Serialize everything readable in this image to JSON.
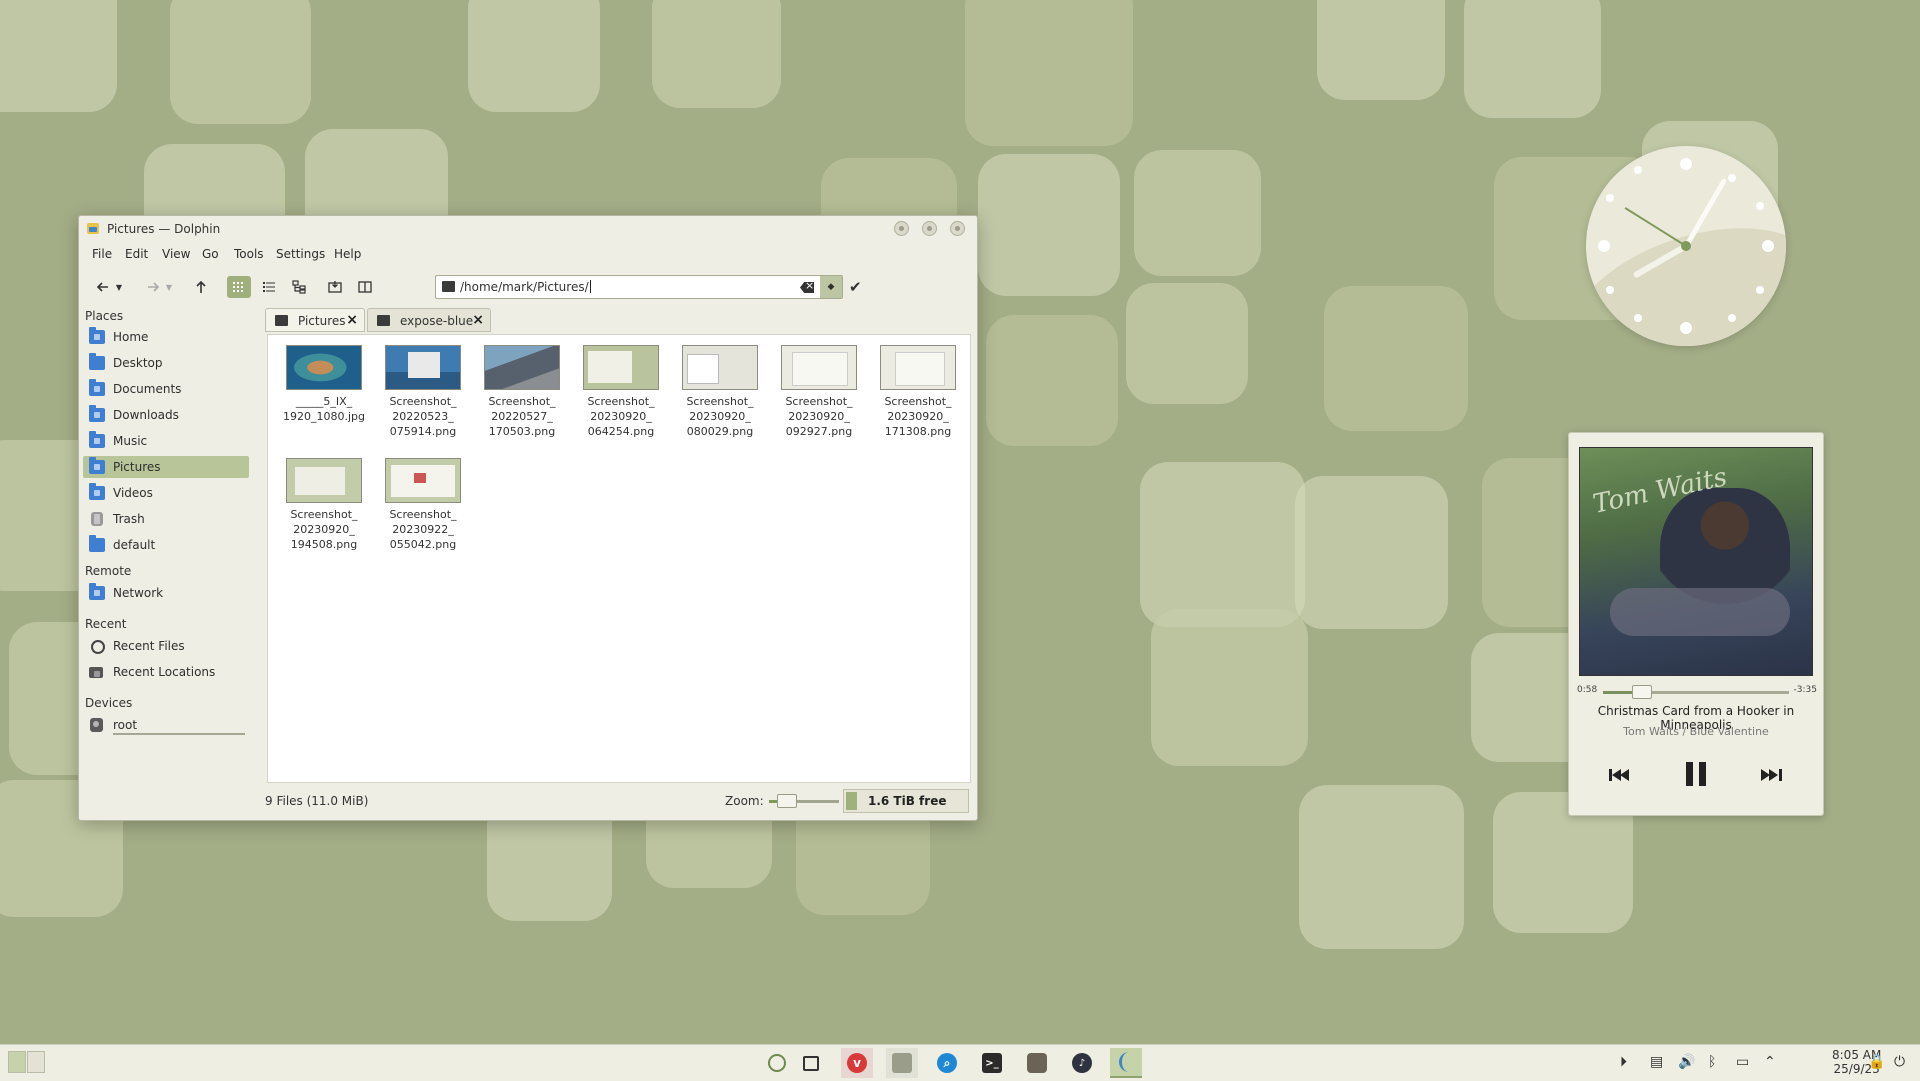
{
  "window": {
    "title": "Pictures — Dolphin",
    "menu": [
      "File",
      "Edit",
      "View",
      "Go",
      "Tools",
      "Settings",
      "Help"
    ],
    "location": "/home/mark/Pictures/",
    "tabs": [
      {
        "label": "Pictures",
        "active": true
      },
      {
        "label": "expose-blue",
        "active": false
      }
    ],
    "sidebar": {
      "places_heading": "Places",
      "places": [
        "Home",
        "Desktop",
        "Documents",
        "Downloads",
        "Music",
        "Pictures",
        "Videos",
        "Trash",
        "default"
      ],
      "selected": "Pictures",
      "remote_heading": "Remote",
      "remote": [
        "Network"
      ],
      "recent_heading": "Recent",
      "recent": [
        "Recent Files",
        "Recent Locations"
      ],
      "devices_heading": "Devices",
      "devices": [
        "root"
      ]
    },
    "files": [
      {
        "name": "_____5_IX_\n1920_1080.jpg"
      },
      {
        "name": "Screenshot_\n20220523_\n075914.png"
      },
      {
        "name": "Screenshot_\n20220527_\n170503.png"
      },
      {
        "name": "Screenshot_\n20230920_\n064254.png"
      },
      {
        "name": "Screenshot_\n20230920_\n080029.png"
      },
      {
        "name": "Screenshot_\n20230920_\n092927.png"
      },
      {
        "name": "Screenshot_\n20230920_\n171308.png"
      },
      {
        "name": "Screenshot_\n20230920_\n194508.png"
      },
      {
        "name": "Screenshot_\n20230922_\n055042.png"
      }
    ],
    "status": {
      "count": "9 Files (11.0 MiB)",
      "zoom_label": "Zoom:",
      "zoom_level": 0.25,
      "free": "1.6 TiB free"
    }
  },
  "media_player": {
    "elapsed": "0:58",
    "remaining": "-3:35",
    "progress": 0.21,
    "track": "Christmas Card from a Hooker in Minneapolis",
    "artist_album": "Tom Waits / Blue Valentine",
    "cover_text": "Tom Waits"
  },
  "taskbar": {
    "tasks": [
      "compass-icon",
      "window-icon",
      "vivaldi-icon",
      "archive-icon",
      "search-app-icon",
      "terminal-icon",
      "gimp-icon",
      "media-icon",
      "dolphin-icon"
    ],
    "active_task": "dolphin-icon",
    "time": "8:05 AM",
    "date": "25/9/23"
  },
  "colors": {
    "accent": "#b7c598",
    "wallpaper": "#a3ad86",
    "window_bg": "#efeee4"
  }
}
